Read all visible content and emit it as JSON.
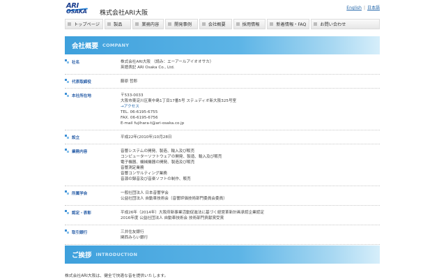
{
  "header": {
    "logo_top": "ARI",
    "logo_bottom": "OSAKA",
    "company_name": "株式会社ARI大阪",
    "lang_en": "English",
    "lang_ja": "日本語",
    "lang_sep": "|"
  },
  "nav": [
    {
      "label": "トップページ"
    },
    {
      "label": "製品"
    },
    {
      "label": "業務内容"
    },
    {
      "label": "開発事例"
    },
    {
      "label": "会社概要"
    },
    {
      "label": "採用情報"
    },
    {
      "label": "新着情報・FAQ"
    },
    {
      "label": "お問い合わせ"
    }
  ],
  "company_section": {
    "title": "会社概要",
    "subtitle": "COMPANY"
  },
  "rows": [
    {
      "label": "社名",
      "lines": [
        "株式会社ARI大阪 （読み：エーアールアイオオサカ）",
        "英語表記 ARI Osaka Co., Ltd."
      ]
    },
    {
      "label": "代表取締役",
      "lines": [
        "藤原 哲郎"
      ]
    },
    {
      "label": "本社所在地",
      "lines": [
        "〒533-0033",
        "大阪市東淀川区東中島1丁目17番5号 ステュディオ新大阪325号室"
      ],
      "link": "→アクセス",
      "lines2": [
        "TEL. 06-6195-6755",
        "FAX. 06-6195-6756",
        "E-mail fujihara-t@ari-osaka.co.jp"
      ]
    },
    {
      "label": "設立",
      "lines": [
        "平成22年(2010年)10月28日"
      ]
    },
    {
      "label": "業務内容",
      "lines": [
        "音響システムの開発、製造、輸入及び販売",
        "コンピューターソフトウェアの開発、製造、輸入及び販売",
        "電子機器、機械機器の開発、製造及び販売",
        "音響測定業務",
        "音響コンサルティング業務",
        "音源の録音及び音楽ソフトの制作、販売"
      ]
    },
    {
      "label": "所属学会",
      "lines": [
        "一般社団法人 日本音響学会",
        "公益社団法人 自動車技術会（音響評価技術部門委員会委員）"
      ]
    },
    {
      "label": "認定・表彰",
      "lines": [
        "平成26年（2014年）大阪府新事業活動促進法に基づく経営革新計画承認企業認定",
        "2016年度 公益社団法人 自動車技術会 技術部門貢献賞受賞"
      ]
    },
    {
      "label": "取引銀行",
      "lines": [
        "三井住友銀行",
        "関西みらい銀行"
      ]
    }
  ],
  "intro_section": {
    "title": "ご挨拶",
    "subtitle": "INTRODUCTION"
  },
  "intro_text": "株式会社ARI大阪は、健全で快適な音を提供いたします。"
}
